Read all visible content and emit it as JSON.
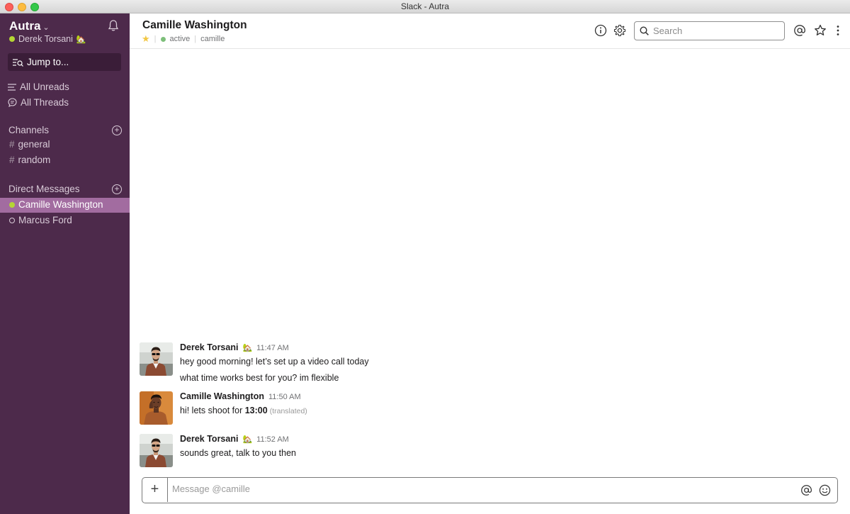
{
  "window": {
    "title": "Slack - Autra"
  },
  "sidebar": {
    "workspace": "Autra",
    "caret": "⌄",
    "user": "Derek Torsani",
    "user_emoji": "🏡",
    "jump_to": "Jump to...",
    "nav": [
      {
        "label": "All Unreads",
        "icon": "lines-icon"
      },
      {
        "label": "All Threads",
        "icon": "thread-icon"
      }
    ],
    "channels_title": "Channels",
    "channels": [
      {
        "label": "general"
      },
      {
        "label": "random"
      }
    ],
    "dm_title": "Direct Messages",
    "dms": [
      {
        "label": "Camille Washington",
        "status": "online",
        "active": true
      },
      {
        "label": "Marcus Ford",
        "status": "away",
        "active": false
      }
    ]
  },
  "header": {
    "name": "Camille Washington",
    "status": "active",
    "handle": "camille",
    "search_placeholder": "Search"
  },
  "messages": [
    {
      "sender": "Derek Torsani",
      "emoji": "🏡",
      "time": "11:47 AM",
      "lines": [
        "hey good morning! let’s set up a video call today",
        "what time works best for you? im flexible"
      ]
    },
    {
      "sender": "Camille Washington",
      "emoji": "",
      "time": "11:50 AM",
      "line_prefix": "hi! lets shoot for ",
      "line_bold": "13:00",
      "line_note": "(translated)"
    },
    {
      "sender": "Derek Torsani",
      "emoji": "🏡",
      "time": "11:52 AM",
      "lines": [
        "sounds great, talk to you then"
      ]
    }
  ],
  "composer": {
    "placeholder": "Message @camille",
    "plus": "+"
  },
  "colors": {
    "sidebar": "#4d2a4b",
    "active_item": "#a26ca0",
    "online": "#b5d534",
    "star": "#f2c744"
  }
}
